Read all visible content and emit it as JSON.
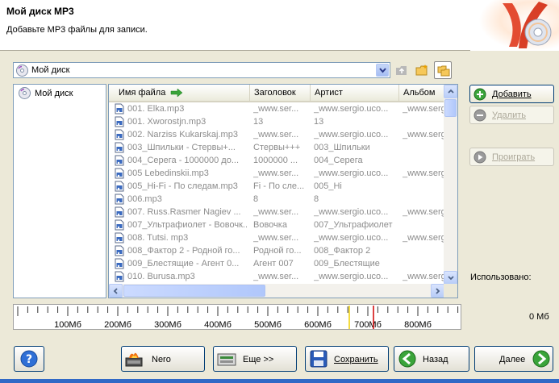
{
  "header": {
    "title": "Мой диск MP3",
    "subtitle": "Добавьте MP3 файлы для записи."
  },
  "location": {
    "value": "Мой диск"
  },
  "tree": {
    "root": "Мой диск"
  },
  "columns": [
    "Имя файла",
    "Заголовок",
    "Артист",
    "Альбом"
  ],
  "files": [
    {
      "name": "001. Elka.mp3",
      "title": "_www.ser...",
      "artist": "_www.sergio.uco...",
      "album": "_www.serg"
    },
    {
      "name": "001. Xworostjn.mp3",
      "title": "13",
      "artist": "13",
      "album": ""
    },
    {
      "name": "002. Narziss Kukarskaj.mp3",
      "title": "_www.ser...",
      "artist": "_www.sergio.uco...",
      "album": "_www.serg"
    },
    {
      "name": "003_Шпильки - Стервы+...",
      "title": "Стервы+++",
      "artist": "003_Шпильки",
      "album": ""
    },
    {
      "name": "004_Серега - 1000000 до...",
      "title": "1000000 ...",
      "artist": "004_Серега",
      "album": ""
    },
    {
      "name": "005 Lebedinskii.mp3",
      "title": "_www.ser...",
      "artist": "_www.sergio.uco...",
      "album": "_www.serg"
    },
    {
      "name": "005_Hi-Fi - По следам.mp3",
      "title": "Fi - По сле...",
      "artist": "005_Hi",
      "album": ""
    },
    {
      "name": "006.mp3",
      "title": "8",
      "artist": "8",
      "album": ""
    },
    {
      "name": "007. Russ.Rasmer Nagiev ...",
      "title": "_www.ser...",
      "artist": "_www.sergio.uco...",
      "album": "_www.serg"
    },
    {
      "name": "007_Ультрафиолет - Вовочк...",
      "title": "Вовочка",
      "artist": "007_Ультрафиолет",
      "album": ""
    },
    {
      "name": "008. Tutsi. mp3",
      "title": "_www.ser...",
      "artist": "_www.sergio.uco...",
      "album": "_www.serg"
    },
    {
      "name": "008_Фактор 2 - Родной го...",
      "title": "Родной го...",
      "artist": "008_Фактор 2",
      "album": ""
    },
    {
      "name": "009_Блестящие - Агент 0...",
      "title": "Агент 007",
      "artist": "009_Блестящие",
      "album": ""
    },
    {
      "name": "010. Burusa.mp3",
      "title": "_www.ser...",
      "artist": "_www.sergio.uco...",
      "album": "_www.serg"
    }
  ],
  "side_buttons": {
    "add": "Добавить",
    "remove": "Удалить",
    "play": "Проиграть"
  },
  "usage": {
    "label": "Использовано:",
    "value": "0 Мб"
  },
  "ruler": {
    "ticks": [
      "100Мб",
      "200Мб",
      "300Мб",
      "400Мб",
      "500Мб",
      "600Мб",
      "700Мб",
      "800Мб"
    ]
  },
  "bottom_buttons": {
    "nero": "Nero",
    "more": "Еще >>",
    "save": "Сохранить",
    "back": "Назад",
    "next": "Далее"
  },
  "colors": {
    "accent": "#003c74",
    "disabled_text": "#aca899",
    "file_text": "#8c8c8c",
    "marker_yellow": "#f0d000",
    "marker_red": "#d00000"
  }
}
